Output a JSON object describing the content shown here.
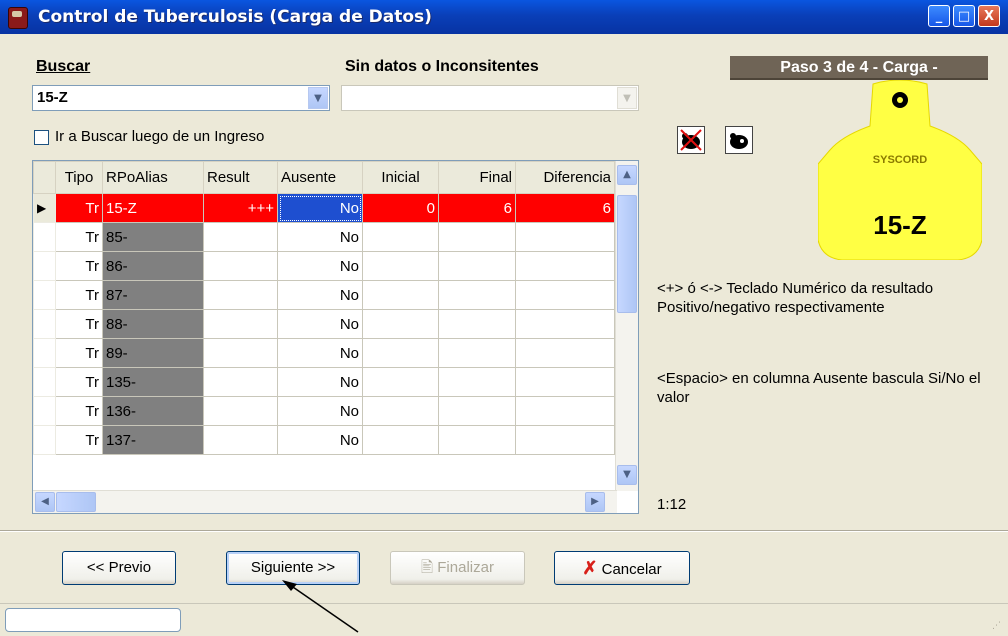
{
  "window": {
    "title": "Control de Tuberculosis (Carga de Datos)",
    "buttons": {
      "minimize": "_",
      "maximize": "□",
      "close": "X"
    }
  },
  "search": {
    "label": "Buscar",
    "value": "15-Z"
  },
  "sin_datos": {
    "label": "Sin datos o Inconsitentes",
    "value": ""
  },
  "options": {
    "ir_a_buscar": "Ir a Buscar luego de un Ingreso",
    "ir_a_buscar_checked": false
  },
  "step": {
    "label": "Paso 3 de 4  - Carga -"
  },
  "ear_tag": {
    "brand": "SYSCORD",
    "id": "15-Z",
    "color": "#ffff44"
  },
  "grid": {
    "columns": [
      "Tipo",
      "RPoAlias",
      "Result",
      "Ausente",
      "Inicial",
      "Final",
      "Diferencia"
    ],
    "rows": [
      {
        "tipo": "Tr",
        "alias": "15-Z",
        "result": "+++",
        "ausente": "No",
        "inicial": "0",
        "final": "6",
        "diferencia": "6",
        "current": true
      },
      {
        "tipo": "Tr",
        "alias": "85-",
        "result": "",
        "ausente": "No",
        "inicial": "",
        "final": "",
        "diferencia": "",
        "current": false
      },
      {
        "tipo": "Tr",
        "alias": "86-",
        "result": "",
        "ausente": "No",
        "inicial": "",
        "final": "",
        "diferencia": "",
        "current": false
      },
      {
        "tipo": "Tr",
        "alias": "87-",
        "result": "",
        "ausente": "No",
        "inicial": "",
        "final": "",
        "diferencia": "",
        "current": false
      },
      {
        "tipo": "Tr",
        "alias": "88-",
        "result": "",
        "ausente": "No",
        "inicial": "",
        "final": "",
        "diferencia": "",
        "current": false
      },
      {
        "tipo": "Tr",
        "alias": "89-",
        "result": "",
        "ausente": "No",
        "inicial": "",
        "final": "",
        "diferencia": "",
        "current": false
      },
      {
        "tipo": "Tr",
        "alias": "135-",
        "result": "",
        "ausente": "No",
        "inicial": "",
        "final": "",
        "diferencia": "",
        "current": false
      },
      {
        "tipo": "Tr",
        "alias": "136-",
        "result": "",
        "ausente": "No",
        "inicial": "",
        "final": "",
        "diferencia": "",
        "current": false
      },
      {
        "tipo": "Tr",
        "alias": "137-",
        "result": "",
        "ausente": "No",
        "inicial": "",
        "final": "",
        "diferencia": "",
        "current": false
      }
    ]
  },
  "help": {
    "line1": "<+> ó <-> Teclado Numérico da resultado Positivo/negativo respectivamente",
    "line2": "<Espacio> en columna Ausente bascula Si/No el valor"
  },
  "counter": "1:12",
  "buttons": {
    "previo": "<< Previo",
    "siguiente": "Siguiente >>",
    "finalizar": "Finalizar",
    "cancelar": "Cancelar"
  },
  "colors": {
    "current_row": "#ff0000",
    "alias_cell": "#808080",
    "step_banner": "#6f6456"
  }
}
